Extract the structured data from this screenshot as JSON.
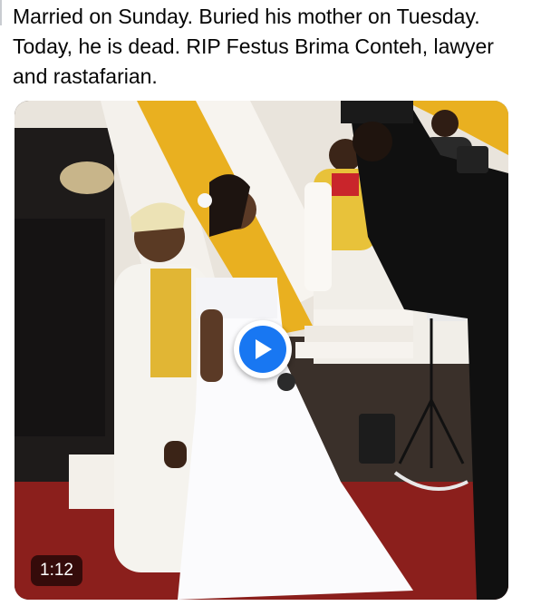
{
  "post": {
    "text": "Married on Sunday. Buried his mother on Tuesday. Today, he is dead. RIP Festus Brima Conteh, lawyer and rastafarian."
  },
  "video": {
    "duration": "1:12",
    "play_icon": "play-icon",
    "accent_color": "#1877f2"
  }
}
